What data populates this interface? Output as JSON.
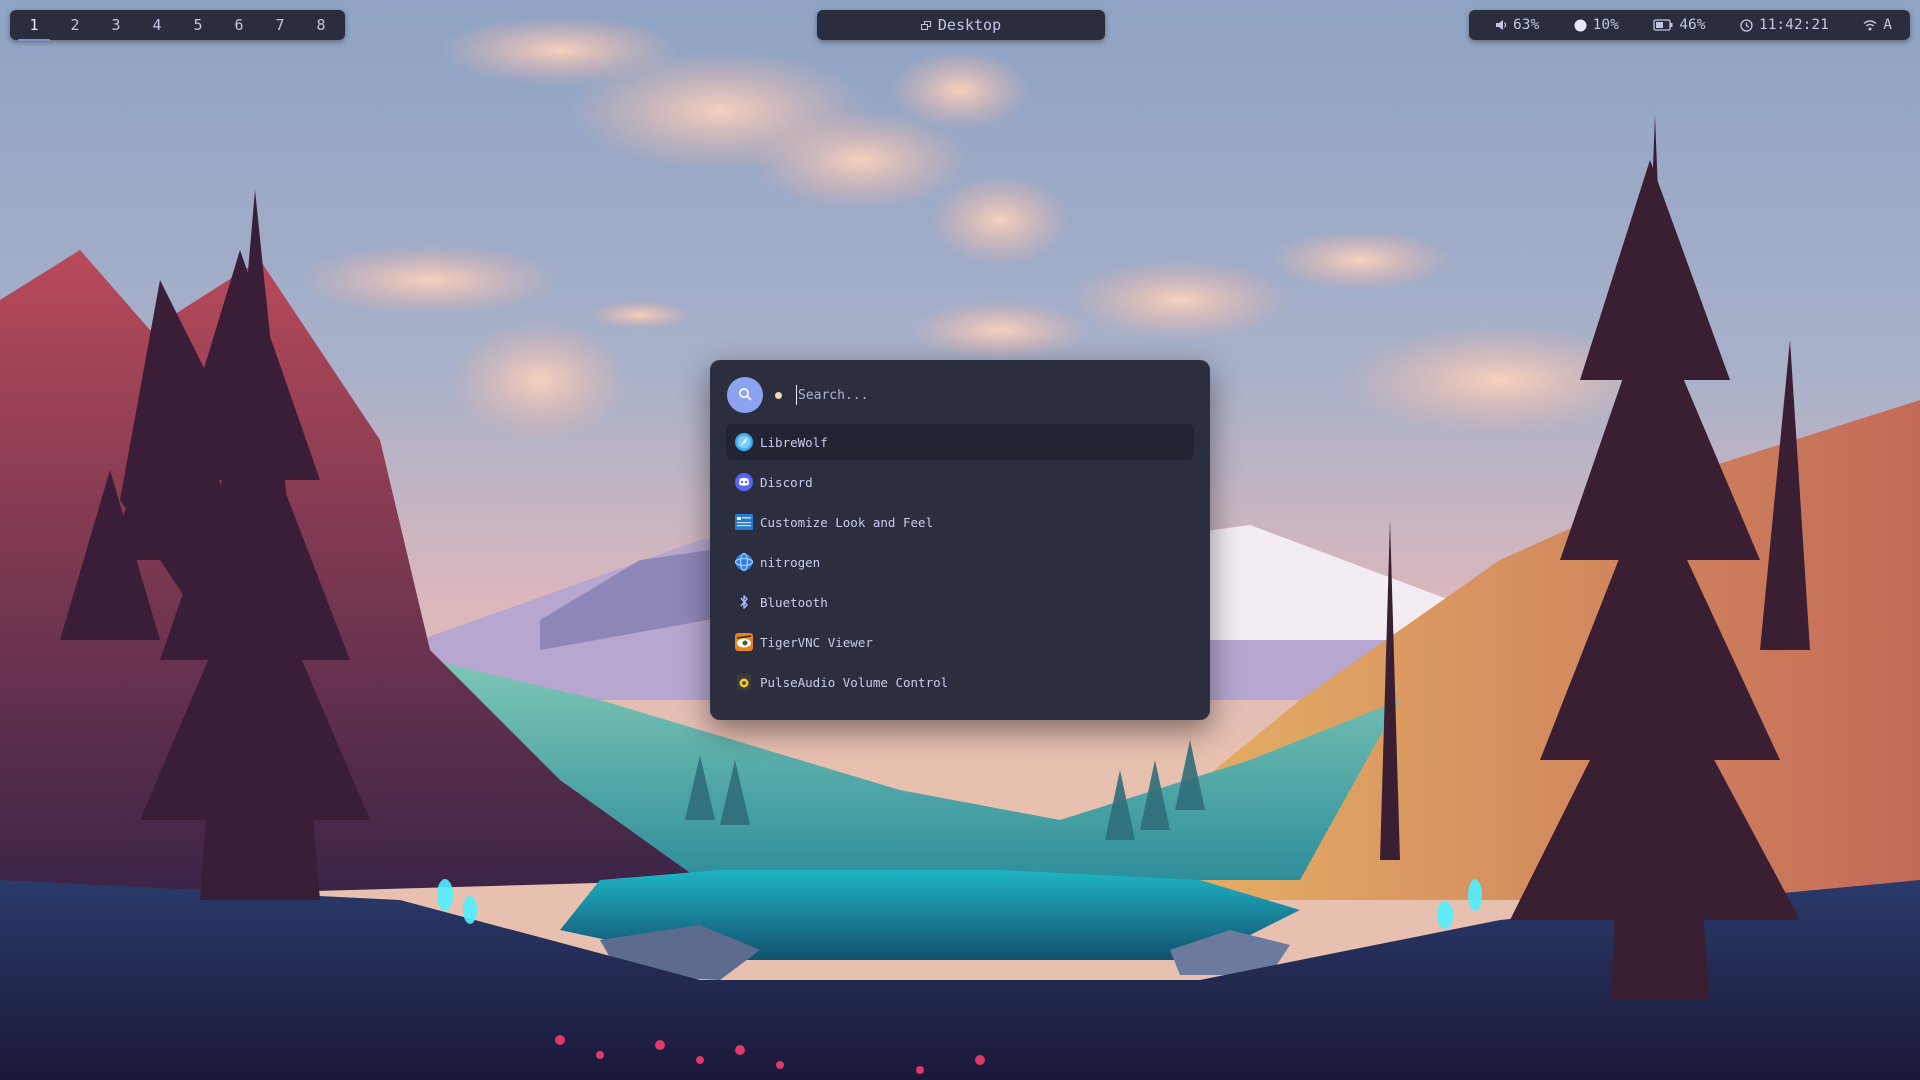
{
  "workspaces": {
    "items": [
      "1",
      "2",
      "3",
      "4",
      "5",
      "6",
      "7",
      "8"
    ],
    "active": "1"
  },
  "window_title": {
    "icon": "window-icon",
    "label": "Desktop"
  },
  "status": {
    "volume": {
      "icon": "speaker-icon",
      "value": "63%"
    },
    "brightness": {
      "icon": "brightness-icon",
      "value": "10%"
    },
    "battery": {
      "icon": "battery-icon",
      "value": "46%"
    },
    "clock": {
      "icon": "clock-icon",
      "value": "11:42:21"
    },
    "network": {
      "icon": "wifi-icon",
      "value": "A"
    }
  },
  "launcher": {
    "search_placeholder": "Search...",
    "accent_color": "#8ea2f2",
    "results": [
      {
        "label": "LibreWolf",
        "icon": "librewolf-icon",
        "selected": true
      },
      {
        "label": "Discord",
        "icon": "discord-icon",
        "selected": false
      },
      {
        "label": "Customize Look and Feel",
        "icon": "appearance-icon",
        "selected": false
      },
      {
        "label": "nitrogen",
        "icon": "nitrogen-icon",
        "selected": false
      },
      {
        "label": "Bluetooth",
        "icon": "bluetooth-icon",
        "selected": false
      },
      {
        "label": "TigerVNC Viewer",
        "icon": "tigervnc-icon",
        "selected": false
      },
      {
        "label": "PulseAudio Volume Control",
        "icon": "pulseaudio-icon",
        "selected": false
      }
    ]
  },
  "colors": {
    "bar_background": "#2a2d3e",
    "launcher_background": "#2b2e3f",
    "selected_row": "#222433",
    "text": "#c8cde8"
  }
}
